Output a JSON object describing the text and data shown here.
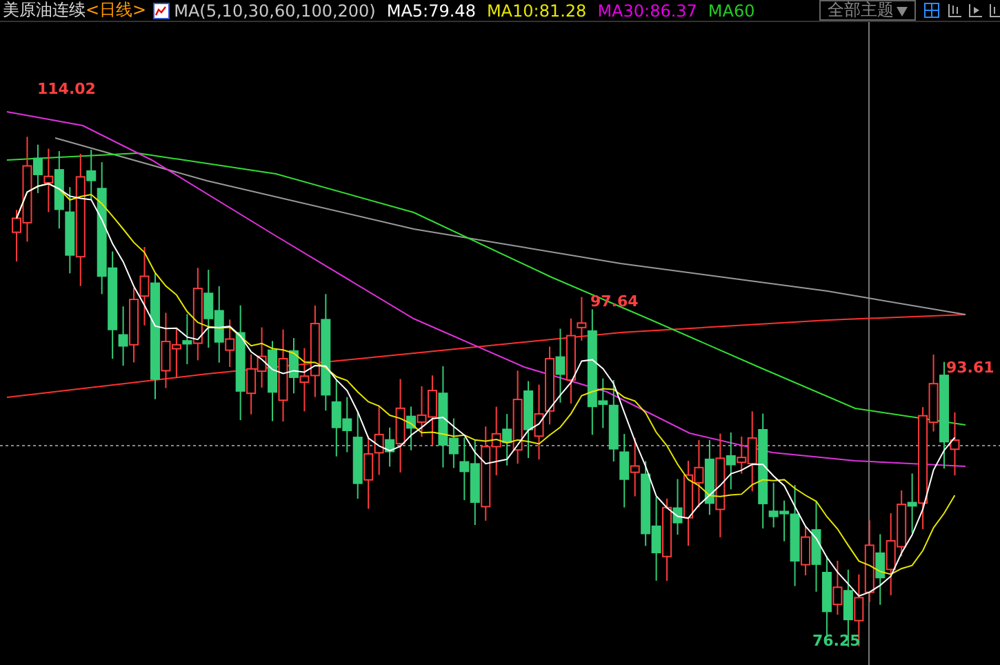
{
  "header": {
    "title": "美原油连续",
    "period": "<日线>",
    "indicator": "MA(5,10,30,60,100,200)",
    "ma_values": [
      {
        "text": "MA5:79.48",
        "color": "#ffffff"
      },
      {
        "text": "MA10:81.28",
        "color": "#e6e600"
      },
      {
        "text": "MA30:86.37",
        "color": "#e600e6"
      },
      {
        "text": "MA60",
        "color": "#22cc22"
      }
    ]
  },
  "theme_button": {
    "label": "全部主题"
  },
  "chart": {
    "price_labels": [
      {
        "text": "114.02",
        "kind": "high"
      },
      {
        "text": "97.64",
        "kind": "high"
      },
      {
        "text": "93.61",
        "kind": "high"
      },
      {
        "text": "76.25",
        "kind": "low"
      }
    ]
  }
}
